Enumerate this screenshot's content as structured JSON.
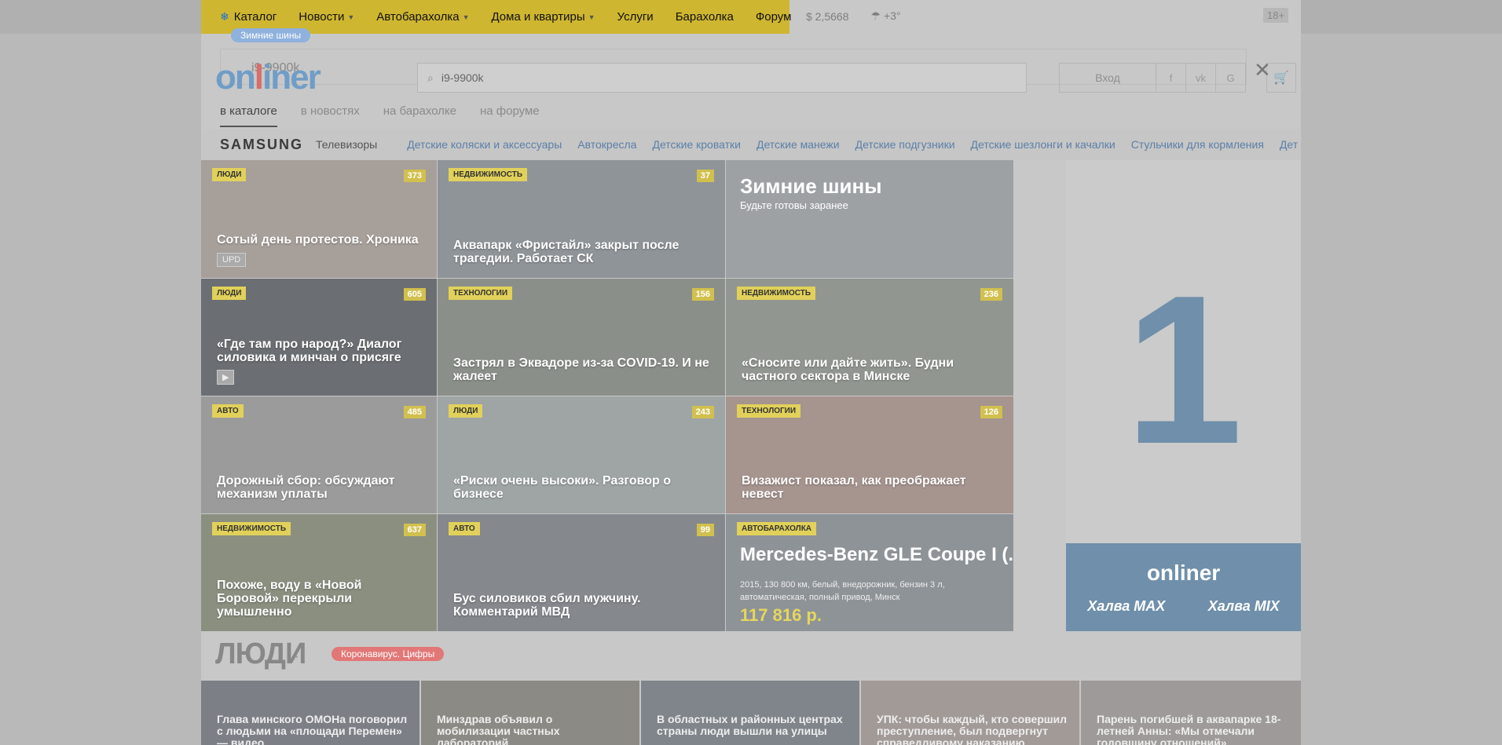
{
  "nav": {
    "items": [
      {
        "label": "Каталог",
        "icon": "snowflake-icon"
      },
      {
        "label": "Новости",
        "dropdown": true
      },
      {
        "label": "Автобарахолка",
        "dropdown": true
      },
      {
        "label": "Дома и квартиры",
        "dropdown": true
      },
      {
        "label": "Услуги"
      },
      {
        "label": "Барахолка"
      },
      {
        "label": "Форум"
      }
    ],
    "rate": "$ 2,5668",
    "weather": "+3°",
    "age": "18+"
  },
  "promo_pill": "Зимние шины",
  "logo": {
    "a": "on",
    "b": "l",
    "c": "iner"
  },
  "search": {
    "value": "i9-9900k",
    "ghost": "i9-9900k"
  },
  "login": {
    "label": "Вход",
    "social": [
      "f",
      "vk",
      "G"
    ]
  },
  "search_tabs": [
    "в каталоге",
    "в новостях",
    "на барахолке",
    "на форуме"
  ],
  "brand": {
    "name": "SAMSUNG",
    "tv": "Телевизоры",
    "cats": [
      "Детские коляски и аксессуары",
      "Автокресла",
      "Детские кроватки",
      "Детские манежи",
      "Детские подгузники",
      "Детские шезлонги и качалки",
      "Стульчики для кормления",
      "Дет"
    ]
  },
  "tiles": [
    {
      "tag": "ЛЮДИ",
      "count": "373",
      "title": "Сотый день протестов. Хроника",
      "badge": "UPD",
      "bg": "#a79f9a"
    },
    {
      "tag": "НЕДВИЖИМОСТЬ",
      "count": "37",
      "title": "Аквапарк «Фристайл» закрыт после трагедии. Работает СК",
      "bg": "#8f9499"
    },
    {
      "hero_title": "Зимние шины",
      "hero_sub": "Будьте готовы заранее",
      "bg": "#9ea1a4"
    },
    {
      "tag": "ЛЮДИ",
      "count": "605",
      "title": "«Где там про народ?» Диалог силовика и минчан о присяге",
      "badge": "▶",
      "bg": "#6b6e72"
    },
    {
      "tag": "ТЕХНОЛОГИИ",
      "count": "156",
      "title": "Застрял в Эквадоре из-за COVID-19. И не жалеет",
      "bg": "#8b8f8a"
    },
    {
      "tag": "НЕДВИЖИМОСТЬ",
      "count": "236",
      "title": "«Сносите или дайте жить». Будни частного сектора в Минске",
      "bg": "#929690"
    },
    {
      "tag": "АВТО",
      "count": "485",
      "title": "Дорожный сбор: обсуждают механизм уплаты",
      "bg": "#9c9b9c"
    },
    {
      "tag": "ЛЮДИ",
      "count": "243",
      "title": "«Риски очень высоки». Разговор о бизнесе",
      "bg": "#9fa5a5"
    },
    {
      "tag": "ТЕХНОЛОГИИ",
      "count": "126",
      "title": "Визажист показал, как преображает невест",
      "bg": "#a6948f"
    },
    {
      "tag": "НЕДВИЖИМОСТЬ",
      "count": "637",
      "title": "Похоже, воду в «Новой Боровой» перекрыли умышленно",
      "bg": "#8a8f80"
    },
    {
      "tag": "АВТО",
      "count": "99",
      "title": "Бус силовиков сбил мужчину. Комментарий МВД",
      "bg": "#85898d"
    },
    {
      "tag": "АВТОБАРАХОЛКА",
      "car_title": "Mercedes-Benz GLE Coupe I (...",
      "car_desc": "2015, 130 800 км, белый, внедорожник, бензин 3 л, автоматическая, полный привод, Минск",
      "car_price": "117 816 р.",
      "bg": "#8e9398"
    }
  ],
  "ad": {
    "digit": "1",
    "brand": "onliner",
    "cards": [
      "Халва MAX",
      "Халва MIX"
    ],
    "accent": "#6f8fab"
  },
  "people": {
    "title": "ЛЮДИ",
    "pill": "Коронавирус. Цифры",
    "news": [
      "Глава минского ОМОНа поговорил с людьми на «площади Перемен» — видео",
      "Минздрав объявил о мобилизации частных лабораторий",
      "В областных и районных центрах страны люди вышли на улицы",
      "УПК: чтобы каждый, кто совершил преступление, был подвергнут справедливому наказанию",
      "Парень погибшей в аквапарке 18-летней Анны: «Мы отмечали годовщину отношений»"
    ]
  }
}
